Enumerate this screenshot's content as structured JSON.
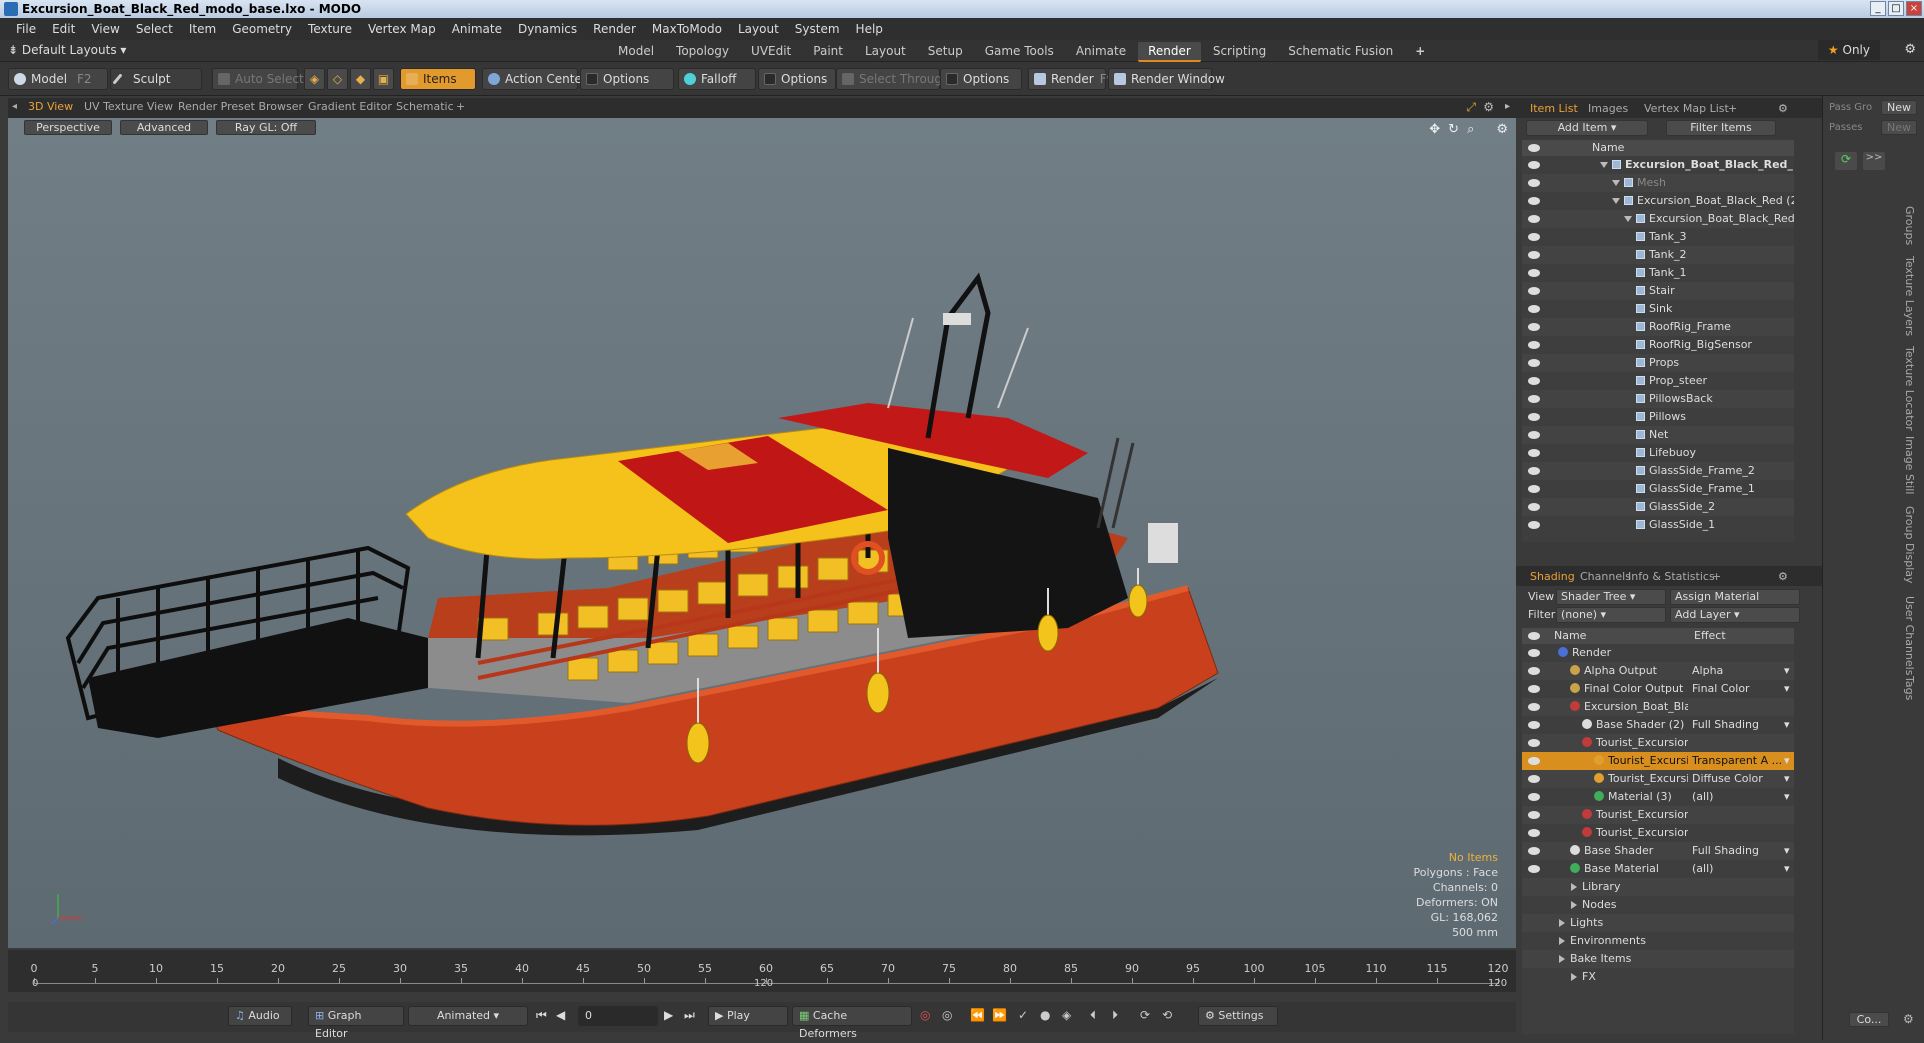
{
  "window": {
    "title": "Excursion_Boat_Black_Red_modo_base.lxo - MODO"
  },
  "menu": [
    "File",
    "Edit",
    "View",
    "Select",
    "Item",
    "Geometry",
    "Texture",
    "Vertex Map",
    "Animate",
    "Dynamics",
    "Render",
    "MaxToModo",
    "Layout",
    "System",
    "Help"
  ],
  "layouts": {
    "default_label": "Default Layouts",
    "tabs": [
      "Model",
      "Topology",
      "UVEdit",
      "Paint",
      "Layout",
      "Setup",
      "Game Tools",
      "Animate",
      "Render",
      "Scripting",
      "Schematic Fusion"
    ],
    "active_tab": "Render",
    "only_label": "Only"
  },
  "toolbar": {
    "model": "Model",
    "model_key": "F2",
    "sculpt": "Sculpt",
    "auto_select": "Auto Select",
    "items": "Items",
    "action_center": "Action Center",
    "options1": "Options",
    "falloff": "Falloff",
    "options2": "Options",
    "select_through": "Select Through",
    "options3": "Options",
    "render": "Render",
    "render_key": "F9",
    "render_window": "Render Window"
  },
  "viewport": {
    "tabs": [
      "3D View",
      "UV Texture View",
      "Render Preset Browser",
      "Gradient Editor",
      "Schematic"
    ],
    "active_tab": "3D View",
    "perspective": "Perspective",
    "advanced": "Advanced",
    "raygl": "Ray GL: Off",
    "stats": {
      "no_items": "No Items",
      "polygons": "Polygons : Face",
      "channels": "Channels: 0",
      "deformers": "Deformers: ON",
      "gl": "GL: 168,062",
      "size": "500 mm"
    }
  },
  "timeline": {
    "ticks": [
      0,
      5,
      10,
      15,
      20,
      25,
      30,
      35,
      40,
      45,
      50,
      55,
      60,
      65,
      70,
      75,
      80,
      85,
      90,
      95,
      100,
      105,
      110,
      115,
      120
    ],
    "start": "0",
    "mid": "120",
    "end": "120"
  },
  "transport": {
    "audio": "Audio",
    "graph_editor": "Graph Editor",
    "animated": "Animated",
    "frame": "0",
    "play": "Play",
    "cache_deformers": "Cache Deformers",
    "settings": "Settings"
  },
  "item_list": {
    "tabs": [
      "Item List",
      "Images",
      "Vertex Map List"
    ],
    "add_item": "Add Item",
    "filter_items": "Filter Items",
    "name_header": "Name",
    "rows": [
      {
        "label": "Excursion_Boat_Black_Red_ ...",
        "indent": 0,
        "bold": true
      },
      {
        "label": "Mesh",
        "indent": 1,
        "dim": true
      },
      {
        "label": "Excursion_Boat_Black_Red (2)",
        "indent": 1
      },
      {
        "label": "Excursion_Boat_Black_Red",
        "indent": 2
      },
      {
        "label": "Tank_3",
        "indent": 3
      },
      {
        "label": "Tank_2",
        "indent": 3
      },
      {
        "label": "Tank_1",
        "indent": 3
      },
      {
        "label": "Stair",
        "indent": 3
      },
      {
        "label": "Sink",
        "indent": 3
      },
      {
        "label": "RoofRig_Frame",
        "indent": 3
      },
      {
        "label": "RoofRig_BigSensor",
        "indent": 3
      },
      {
        "label": "Props",
        "indent": 3
      },
      {
        "label": "Prop_steer",
        "indent": 3
      },
      {
        "label": "PillowsBack",
        "indent": 3
      },
      {
        "label": "Pillows",
        "indent": 3
      },
      {
        "label": "Net",
        "indent": 3
      },
      {
        "label": "Lifebuoy",
        "indent": 3
      },
      {
        "label": "GlassSide_Frame_2",
        "indent": 3
      },
      {
        "label": "GlassSide_Frame_1",
        "indent": 3
      },
      {
        "label": "GlassSide_2",
        "indent": 3
      },
      {
        "label": "GlassSide_1",
        "indent": 3
      }
    ]
  },
  "shading": {
    "tabs": [
      "Shading",
      "Channels",
      "Info & Statistics"
    ],
    "view_label": "View",
    "view_value": "Shader Tree",
    "assign_material": "Assign Material",
    "filter_label": "Filter",
    "filter_value": "(none)",
    "add_layer": "Add Layer",
    "name_header": "Name",
    "effect_header": "Effect",
    "rows": [
      {
        "label": "Render",
        "effect": "",
        "indent": 0,
        "color": "#4a6fd6"
      },
      {
        "label": "Alpha Output",
        "effect": "Alpha",
        "indent": 1,
        "color": "#c9a24a"
      },
      {
        "label": "Final Color Output",
        "effect": "Final Color",
        "indent": 1,
        "color": "#c9a24a"
      },
      {
        "label": "Excursion_Boat_Black_...",
        "effect": "",
        "indent": 1,
        "color": "#c23b3b"
      },
      {
        "label": "Base Shader (2)",
        "effect": "Full Shading",
        "indent": 2,
        "color": "#dddddd"
      },
      {
        "label": "Tourist_Excursion_b ...",
        "effect": "",
        "indent": 2,
        "color": "#c23b3b"
      },
      {
        "label": "Tourist_Excursion ...",
        "effect": "Transparent A ...",
        "indent": 3,
        "color": "#e0a030",
        "selected": true
      },
      {
        "label": "Tourist_Excursion ...",
        "effect": "Diffuse Color",
        "indent": 3,
        "color": "#e0a030"
      },
      {
        "label": "Material (3)",
        "effect": "(all)",
        "indent": 3,
        "color": "#3fae5a"
      },
      {
        "label": "Tourist_Excursion_b ...",
        "effect": "",
        "indent": 2,
        "color": "#c23b3b"
      },
      {
        "label": "Tourist_Excursion_b ...",
        "effect": "",
        "indent": 2,
        "color": "#c23b3b"
      },
      {
        "label": "Base Shader",
        "effect": "Full Shading",
        "indent": 1,
        "color": "#dddddd"
      },
      {
        "label": "Base Material",
        "effect": "(all)",
        "indent": 1,
        "color": "#3fae5a"
      },
      {
        "label": "Library",
        "effect": "",
        "indent": 1,
        "color": ""
      },
      {
        "label": "Nodes",
        "effect": "",
        "indent": 1,
        "color": ""
      },
      {
        "label": "Lights",
        "effect": "",
        "indent": 0,
        "color": ""
      },
      {
        "label": "Environments",
        "effect": "",
        "indent": 0,
        "color": ""
      },
      {
        "label": "Bake Items",
        "effect": "",
        "indent": 0,
        "color": ""
      },
      {
        "label": "FX",
        "effect": "",
        "indent": 1,
        "color": ""
      }
    ]
  },
  "side": {
    "pass_group": "Pass Gro",
    "passes": "Passes",
    "new": "New",
    "vertical_tabs": [
      "Groups",
      "Texture Layers",
      "Texture Locator",
      "Image Still",
      "Group Display",
      "User Channels",
      "Tags"
    ],
    "bottom_btn": "Co..."
  },
  "colors": {
    "accent": "#e8a23a",
    "hull": "#c8401c",
    "roof_red": "#c01616",
    "roof_yellow": "#f4c21a",
    "seat": "#f2c024"
  }
}
